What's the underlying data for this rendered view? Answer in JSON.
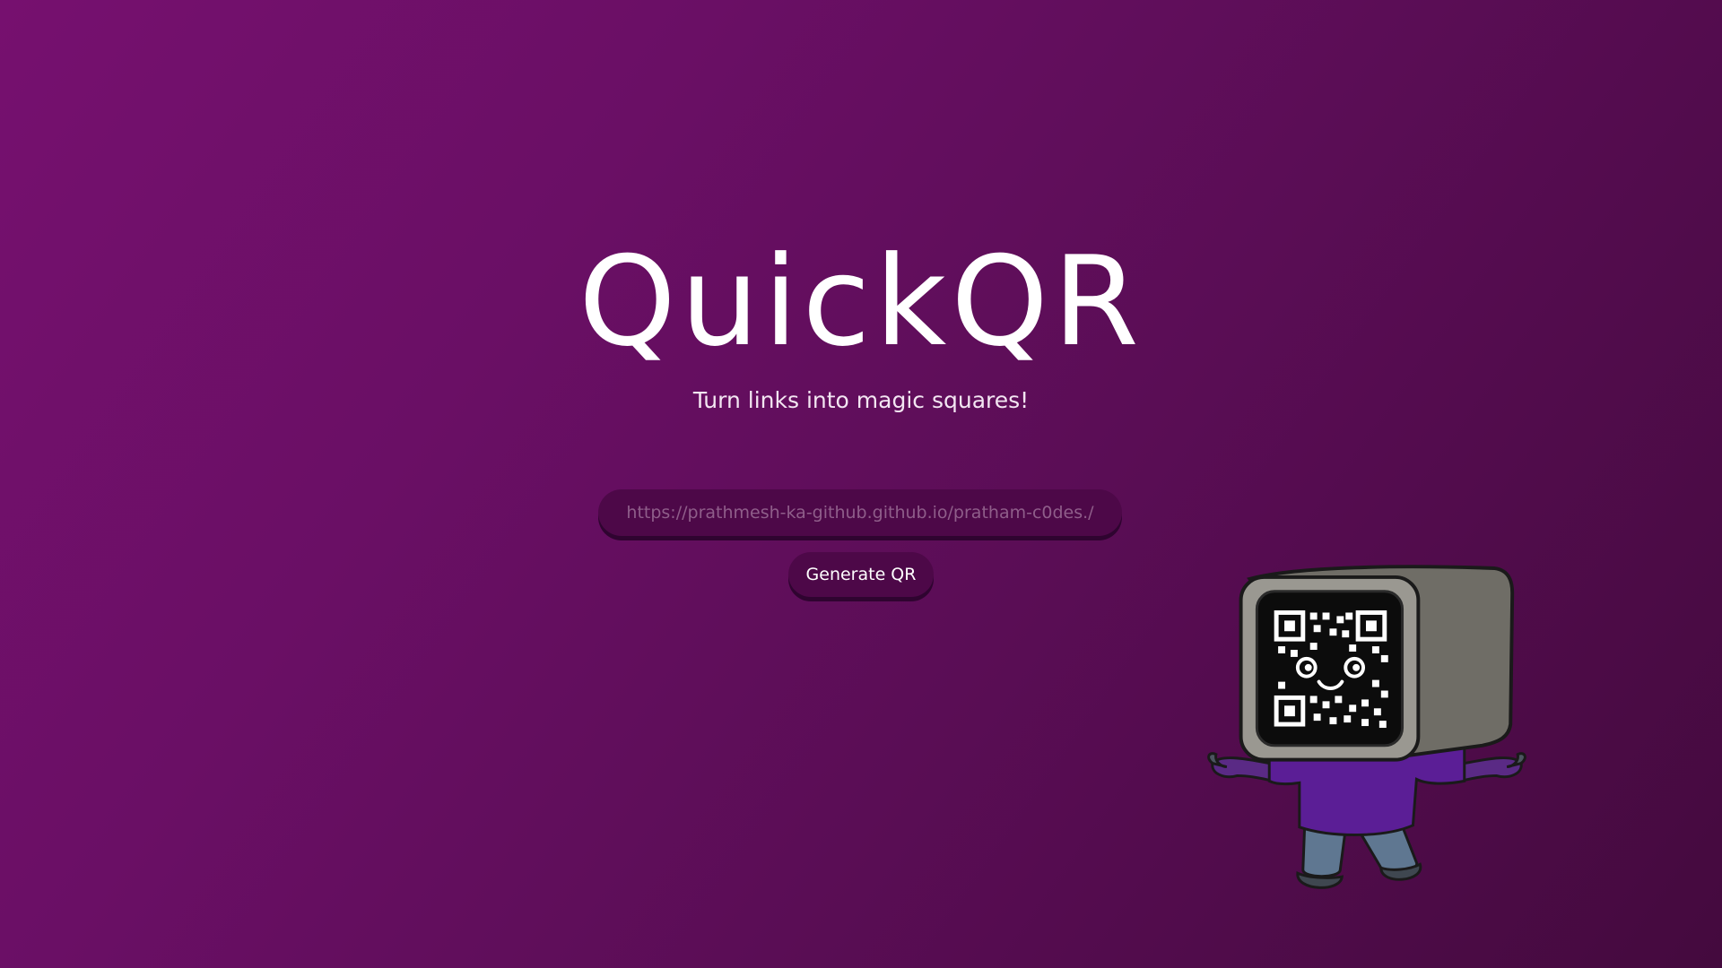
{
  "header": {
    "title": "QuickQR",
    "subtitle": "Turn links into magic squares!"
  },
  "form": {
    "url_placeholder": "https://prathmesh-ka-github.github.io/pratham-c0des./",
    "generate_label": "Generate QR"
  },
  "mascot": {
    "icon": "qr-tv-mascot-icon"
  },
  "colors": {
    "background_start": "#76106f",
    "background_end": "#440a3e",
    "control_fill": "#4d0848",
    "text": "#ffffff"
  }
}
